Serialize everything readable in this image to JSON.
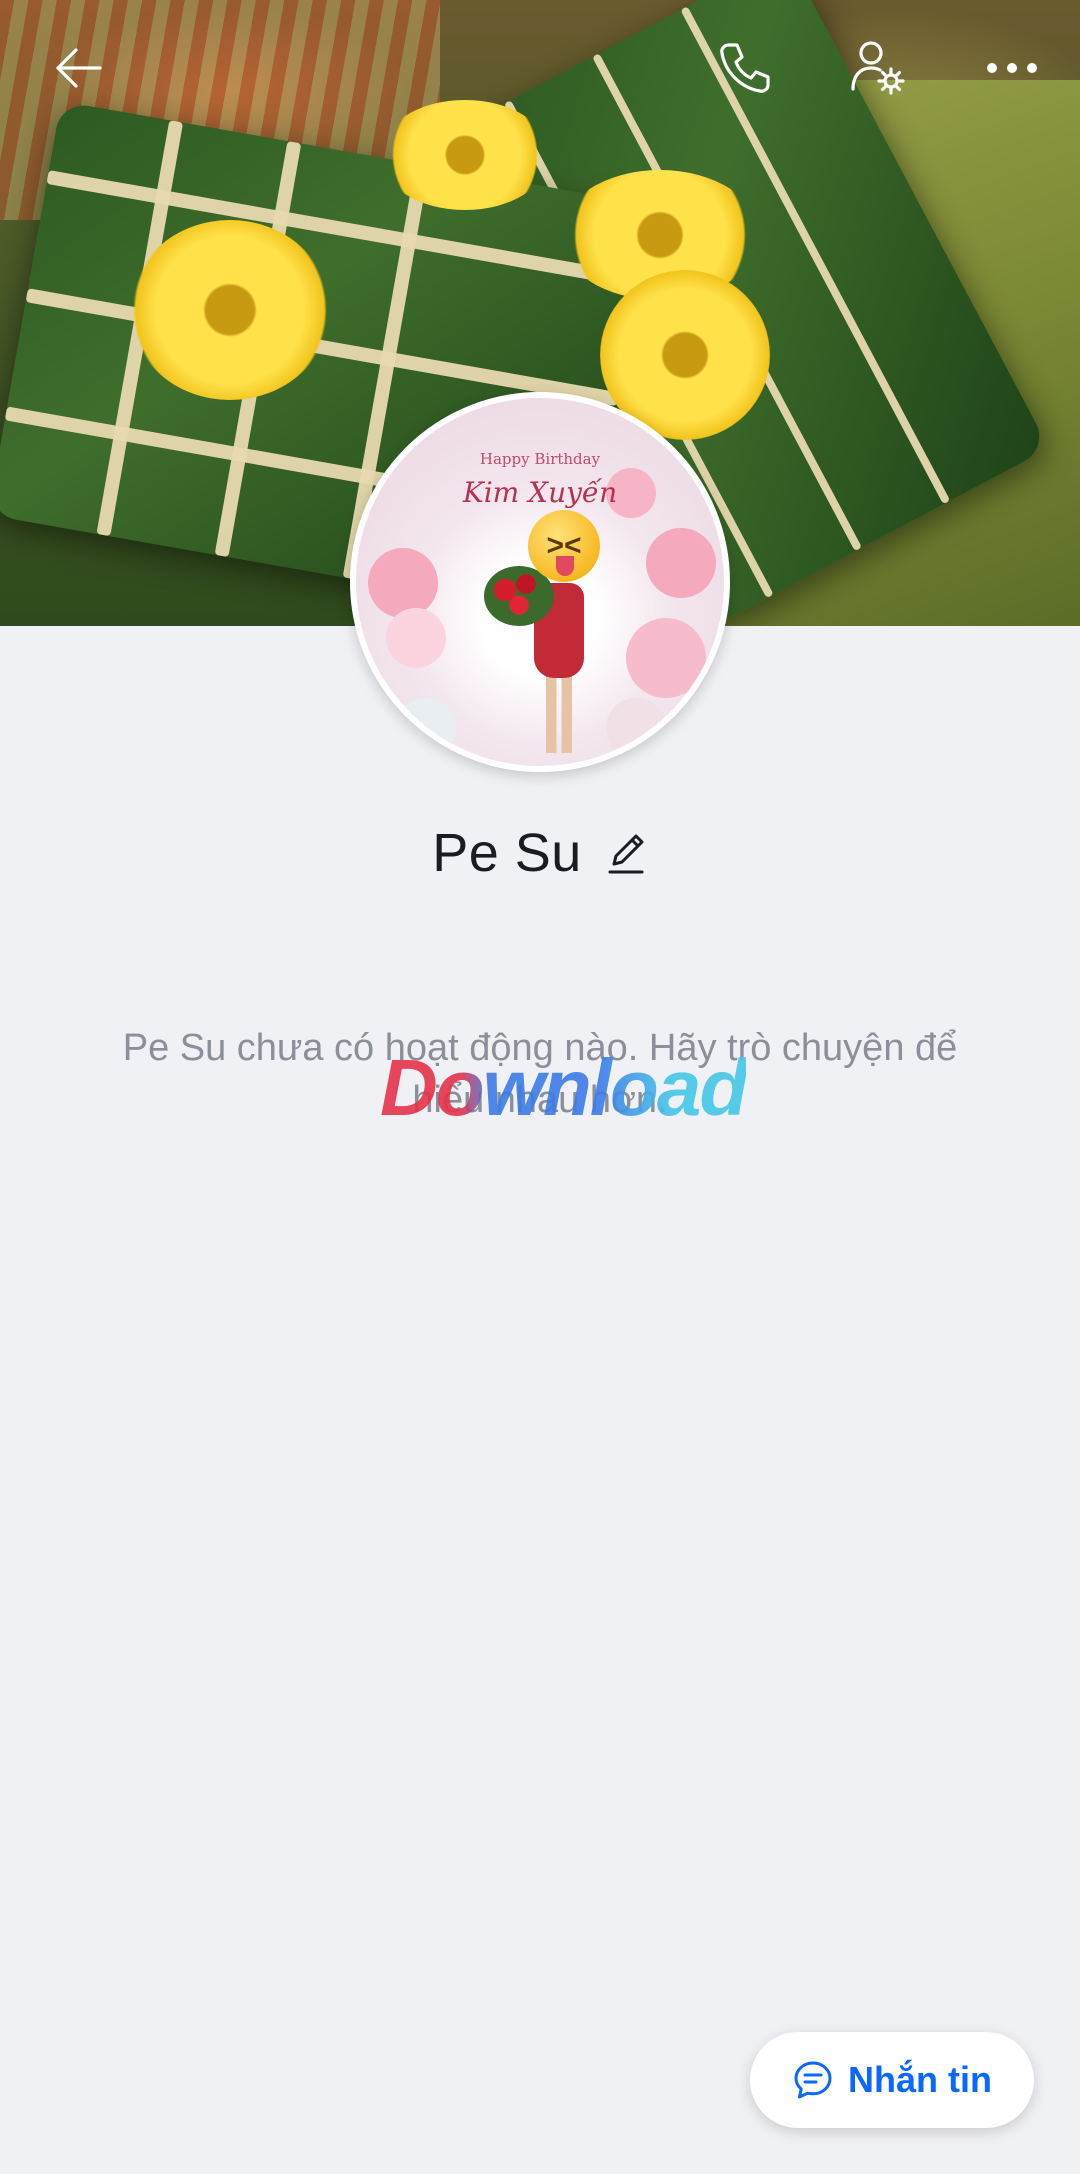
{
  "header": {
    "icons": {
      "back": "arrow-left-icon",
      "call": "phone-icon",
      "settings": "user-settings-icon",
      "more": "more-horizontal-icon"
    }
  },
  "profile": {
    "name": "Pe Su",
    "avatar_text_line1": "Happy Birthday",
    "avatar_text_line2": "Kim Xuyến",
    "edit_icon": "pencil-icon"
  },
  "feed": {
    "empty_message": "Pe Su chưa có hoạt động nào. Hãy trò chuyện để hiểu nhau hơn.",
    "watermark": "Download"
  },
  "actions": {
    "message_button_label": "Nhắn tin",
    "message_icon": "chat-bubble-icon"
  },
  "colors": {
    "accent": "#0a68fe",
    "background": "#f0f1f5",
    "text_primary": "#1a1c21",
    "text_secondary": "#8a8f99"
  }
}
